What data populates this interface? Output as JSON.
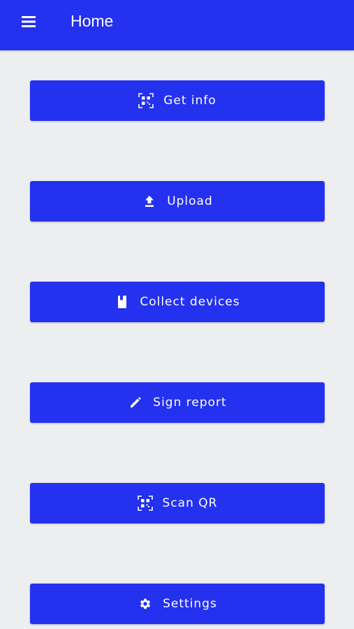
{
  "app_bar": {
    "title": "Home",
    "menu_icon": "hamburger-menu-icon",
    "color": "#2431ee"
  },
  "colors": {
    "primary": "#2431ee",
    "background": "#eceef0",
    "on_primary": "#ffffff"
  },
  "actions": [
    {
      "label": "Get info",
      "icon": "qr-code-icon"
    },
    {
      "label": "Upload",
      "icon": "upload-icon"
    },
    {
      "label": "Collect devices",
      "icon": "bookmark-icon"
    },
    {
      "label": "Sign report",
      "icon": "pencil-icon"
    },
    {
      "label": "Scan QR",
      "icon": "qr-code-icon"
    },
    {
      "label": "Settings",
      "icon": "gear-icon"
    }
  ]
}
